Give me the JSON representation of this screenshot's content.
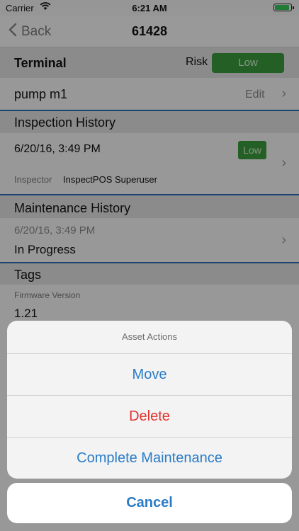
{
  "status": {
    "carrier": "Carrier",
    "time": "6:21 AM"
  },
  "nav": {
    "back_label": "Back",
    "title": "61428"
  },
  "terminal": {
    "title": "Terminal",
    "risk_label": "Risk",
    "risk_value": "Low",
    "name": "pump m1",
    "edit_label": "Edit"
  },
  "inspection": {
    "title": "Inspection History",
    "date": "6/20/16, 3:49 PM",
    "badge": "Low",
    "inspector_label": "Inspector",
    "inspector_name": "InspectPOS Superuser"
  },
  "maintenance": {
    "title": "Maintenance History",
    "date": "6/20/16, 3:49 PM",
    "status": "In Progress"
  },
  "tags": {
    "title": "Tags",
    "field_label": "Firmware Version",
    "field_value": "1.21"
  },
  "sheet": {
    "title": "Asset Actions",
    "actions": [
      {
        "label": "Move",
        "color": "#2a7cc7"
      },
      {
        "label": "Delete",
        "color": "#e0322f"
      },
      {
        "label": "Complete Maintenance",
        "color": "#2a7cc7"
      }
    ],
    "cancel": "Cancel"
  }
}
